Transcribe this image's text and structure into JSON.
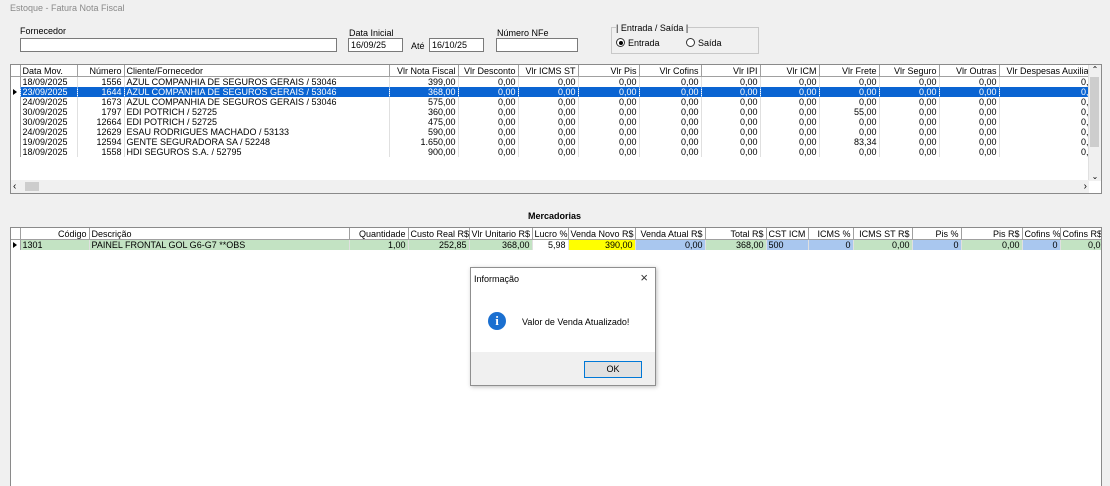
{
  "window": {
    "title": "Estoque - Fatura Nota Fiscal"
  },
  "filters": {
    "fornecedor_label": "Fornecedor",
    "fornecedor_value": "",
    "data_inicial_label": "Data Inicial",
    "data_inicial_value": "16/09/25",
    "ate_label": "Até",
    "data_final_value": "16/10/25",
    "nfe_label": "Número NFe",
    "nfe_value": "",
    "tipo_group_label": "| Entrada / Saída |",
    "entrada_label": "Entrada",
    "saida_label": "Saída",
    "selected": "Entrada"
  },
  "invoices": {
    "columns": [
      "Data Mov.",
      "Número",
      "Cliente/Fornecedor",
      "Vlr Nota Fiscal",
      "Vlr Desconto",
      "Vlr ICMS ST",
      "Vlr Pis",
      "Vlr Cofins",
      "Vlr IPI",
      "Vlr ICM",
      "Vlr Frete",
      "Vlr Seguro",
      "Vlr Outras",
      "Vlr Despesas Auxilia"
    ],
    "rows": [
      [
        "18/09/2025",
        "1556",
        "AZUL COMPANHIA DE SEGUROS GERAIS / 53046",
        "399,00",
        "0,00",
        "0,00",
        "0,00",
        "0,00",
        "0,00",
        "0,00",
        "0,00",
        "0,00",
        "0,00",
        "0,"
      ],
      [
        "23/09/2025",
        "1644",
        "AZUL COMPANHIA DE SEGUROS GERAIS / 53046",
        "368,00",
        "0,00",
        "0,00",
        "0,00",
        "0,00",
        "0,00",
        "0,00",
        "0,00",
        "0,00",
        "0,00",
        "0,"
      ],
      [
        "24/09/2025",
        "1673",
        "AZUL COMPANHIA DE SEGUROS GERAIS / 53046",
        "575,00",
        "0,00",
        "0,00",
        "0,00",
        "0,00",
        "0,00",
        "0,00",
        "0,00",
        "0,00",
        "0,00",
        "0,"
      ],
      [
        "30/09/2025",
        "1797",
        "EDI POTRICH  / 52725",
        "360,00",
        "0,00",
        "0,00",
        "0,00",
        "0,00",
        "0,00",
        "0,00",
        "55,00",
        "0,00",
        "0,00",
        "0,"
      ],
      [
        "30/09/2025",
        "12664",
        "EDI POTRICH  / 52725",
        "475,00",
        "0,00",
        "0,00",
        "0,00",
        "0,00",
        "0,00",
        "0,00",
        "0,00",
        "0,00",
        "0,00",
        "0,"
      ],
      [
        "24/09/2025",
        "12629",
        "ESAU RODRIGUES MACHADO / 53133",
        "590,00",
        "0,00",
        "0,00",
        "0,00",
        "0,00",
        "0,00",
        "0,00",
        "0,00",
        "0,00",
        "0,00",
        "0,"
      ],
      [
        "19/09/2025",
        "12594",
        "GENTE SEGURADORA SA / 52248",
        "1.650,00",
        "0,00",
        "0,00",
        "0,00",
        "0,00",
        "0,00",
        "0,00",
        "83,34",
        "0,00",
        "0,00",
        "0,"
      ],
      [
        "18/09/2025",
        "1558",
        "HDI SEGUROS S.A. / 52795",
        "900,00",
        "0,00",
        "0,00",
        "0,00",
        "0,00",
        "0,00",
        "0,00",
        "0,00",
        "0,00",
        "0,00",
        "0,"
      ]
    ],
    "selected_row": 1
  },
  "merchandise": {
    "section_title": "Mercadorias",
    "columns": [
      "Código",
      "Descrição",
      "Quantidade",
      "Custo Real R$",
      "Vlr Unitario R$",
      "Lucro %",
      "Venda Novo R$",
      "Venda Atual R$",
      "Total R$",
      "CST ICM",
      "ICMS %",
      "ICMS ST R$",
      "Pis %",
      "Pis R$",
      "Cofins %",
      "Cofins R$"
    ],
    "rows": [
      [
        "1301",
        "PAINEL FRONTAL GOL G6-G7 **OBS",
        "1,00",
        "252,85",
        "368,00",
        "5,98",
        "390,00",
        "0,00",
        "368,00",
        "500",
        "0",
        "0,00",
        "0",
        "0,00",
        "0",
        "0,0"
      ]
    ]
  },
  "dialog": {
    "title": "Informação",
    "message": "Valor de Venda Atualizado!",
    "ok_label": "OK"
  },
  "colors": {
    "selection": "#0a64d2",
    "row_green": "#c3e3c3",
    "cell_yellow": "#ffff00",
    "cell_blue": "#a9c7ef",
    "info_blue": "#1a6fd0"
  }
}
